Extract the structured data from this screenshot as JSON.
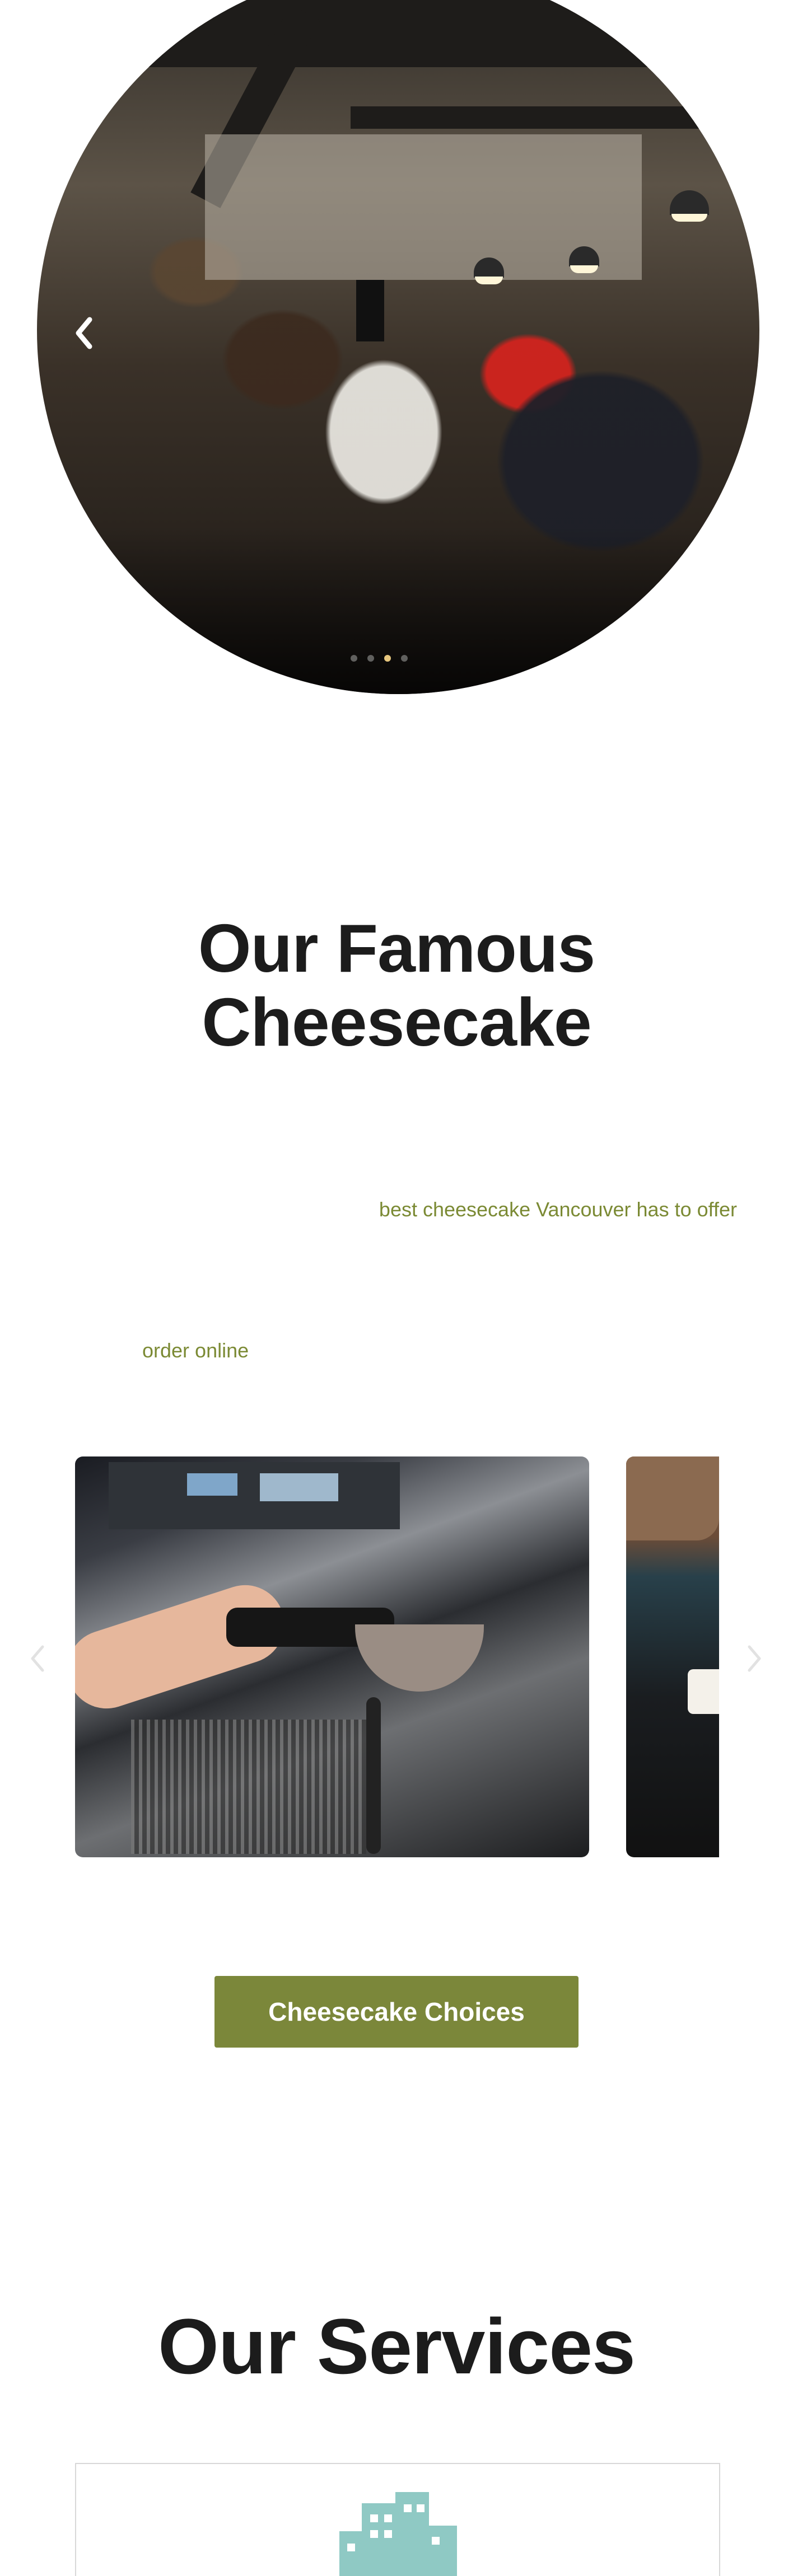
{
  "hero": {
    "image_alt": "Cafe interior with live music performers and seated guests",
    "prev_icon": "chevron-left-icon"
  },
  "famous": {
    "title_line1": "Our Famous",
    "title_line2": "Cheesecake",
    "tagline": "best cheesecake Vancouver has to offer",
    "order_link": "order online"
  },
  "carousel": {
    "prev_icon": "chevron-left-icon",
    "next_icon": "chevron-right-icon",
    "slides": [
      {
        "alt": "Barista using an espresso machine"
      },
      {
        "alt": "Coffee being served"
      }
    ]
  },
  "choices_button": "Cheesecake Choices",
  "services": {
    "title": "Our Services",
    "card_icon": "city-buildings-icon"
  },
  "colors": {
    "accent": "#7b873a",
    "text_link": "#7b8a34",
    "heading": "#1c1c1c",
    "icon_teal": "#8fc9c4"
  }
}
